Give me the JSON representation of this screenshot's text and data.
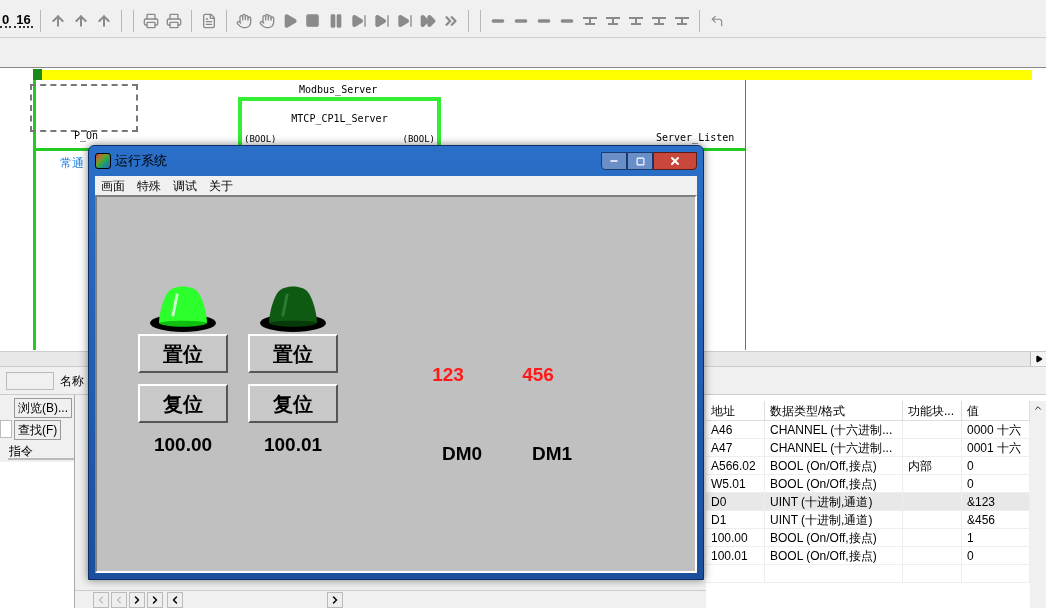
{
  "toolbar": {
    "counters": [
      "0",
      "16"
    ]
  },
  "ladder": {
    "rung_label": "P_On",
    "rung_comment": "常通",
    "block_title": "Modbus_Server",
    "block_name": "MTCP_CP1L_Server",
    "block_in": "(BOOL)",
    "block_out": "(BOOL)",
    "output_label": "Server_Listen"
  },
  "search_panel": {
    "name_label": "名称",
    "browse_button": "浏览(B)...",
    "find_button": "查找(F)",
    "column": "指令"
  },
  "watch_table": {
    "columns": [
      "地址",
      "数据类型/格式",
      "功能块...",
      "值"
    ],
    "rows": [
      {
        "address": "A46",
        "type": "CHANNEL (十六进制...",
        "column_3": "",
        "value": "0000 十六",
        "selected": false
      },
      {
        "address": "A47",
        "type": "CHANNEL (十六进制...",
        "column_3": "",
        "value": "0001 十六",
        "selected": false
      },
      {
        "address": "A566.02",
        "type": "BOOL (On/Off,接点)",
        "column_3": "内部",
        "value": "0",
        "selected": false
      },
      {
        "address": "W5.01",
        "type": "BOOL (On/Off,接点)",
        "column_3": "",
        "value": "0",
        "selected": false
      },
      {
        "address": "D0",
        "type": "UINT (十进制,通道)",
        "column_3": "",
        "value": "&123",
        "selected": true
      },
      {
        "address": "D1",
        "type": "UINT (十进制,通道)",
        "column_3": "",
        "value": "&456",
        "selected": false
      },
      {
        "address": "100.00",
        "type": "BOOL (On/Off,接点)",
        "column_3": "",
        "value": "1",
        "selected": false
      },
      {
        "address": "100.01",
        "type": "BOOL (On/Off,接点)",
        "column_3": "",
        "value": "0",
        "selected": false
      }
    ]
  },
  "runtime_window": {
    "title": "运行系统",
    "menus": [
      "画面",
      "特殊",
      "调试",
      "关于"
    ],
    "lamps": [
      {
        "on": true,
        "set_button": "置位",
        "reset_button": "复位",
        "address": "100.00"
      },
      {
        "on": false,
        "set_button": "置位",
        "reset_button": "复位",
        "address": "100.01"
      }
    ],
    "displays": [
      {
        "value": "123",
        "label": "DM0"
      },
      {
        "value": "456",
        "label": "DM1"
      }
    ]
  }
}
